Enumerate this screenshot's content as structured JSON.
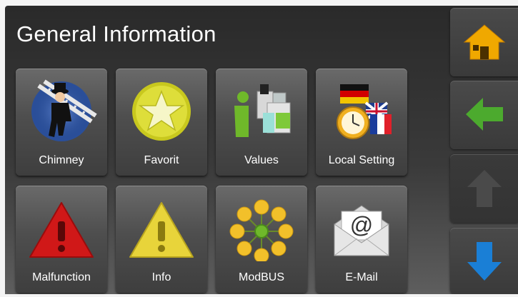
{
  "header": {
    "title": "General Information"
  },
  "tiles": [
    {
      "label": "Chimney",
      "icon": "chimney-sweep-icon"
    },
    {
      "label": "Favorit",
      "icon": "star-icon"
    },
    {
      "label": "Values",
      "icon": "values-info-icon"
    },
    {
      "label": "Local Setting",
      "icon": "flags-clock-icon"
    },
    {
      "label": "Malfunction",
      "icon": "warning-red-icon"
    },
    {
      "label": "Info",
      "icon": "warning-yellow-icon"
    },
    {
      "label": "ModBUS",
      "icon": "network-nodes-icon"
    },
    {
      "label": "E-Mail",
      "icon": "email-envelope-icon"
    }
  ],
  "sidebar": {
    "home": {
      "icon": "home-icon",
      "color": "#f0a800"
    },
    "back": {
      "icon": "arrow-left-icon",
      "color": "#4caa2e"
    },
    "up": {
      "icon": "arrow-up-icon",
      "color": "#4a4a4a"
    },
    "down": {
      "icon": "arrow-down-icon",
      "color": "#1a7fd6"
    }
  }
}
